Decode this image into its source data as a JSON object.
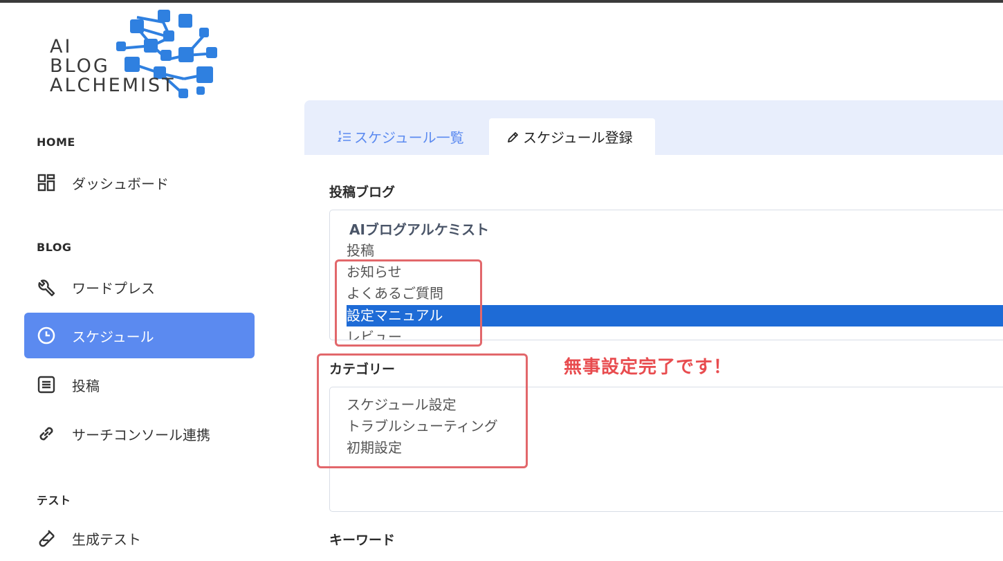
{
  "logo": {
    "line1": "AI",
    "line2": "BLOG",
    "line3": "ALCHEMIST"
  },
  "sidebar": {
    "sections": [
      {
        "title": "HOME"
      },
      {
        "title": "BLOG"
      },
      {
        "title": "テスト"
      }
    ],
    "items": [
      {
        "label": "ダッシュボード",
        "icon": "dashboard-icon"
      },
      {
        "label": "ワードプレス",
        "icon": "wrench-icon"
      },
      {
        "label": "スケジュール",
        "icon": "clock-icon",
        "active": true
      },
      {
        "label": "投稿",
        "icon": "document-icon"
      },
      {
        "label": "サーチコンソール連携",
        "icon": "link-icon"
      },
      {
        "label": "生成テスト",
        "icon": "flask-icon"
      }
    ]
  },
  "tabs": [
    {
      "label": "スケジュール一覧",
      "icon": "list-numbered-icon",
      "active": false
    },
    {
      "label": "スケジュール登録",
      "icon": "pencil-icon",
      "active": true
    }
  ],
  "form": {
    "blog_label": "投稿ブログ",
    "blog_group": "AIブログアルケミスト",
    "blog_options": [
      "投稿",
      "お知らせ",
      "よくあるご質問",
      "設定マニュアル",
      "レビュー"
    ],
    "blog_selected": "設定マニュアル",
    "category_label": "カテゴリー",
    "category_options": [
      "スケジュール設定",
      "トラブルシューティング",
      "初期設定"
    ],
    "keyword_label": "キーワード"
  },
  "annotation": "無事設定完了です！",
  "colors": {
    "accent": "#5b8af0",
    "selected": "#1e6bd6",
    "annotation_red": "#e84c4f",
    "tabbar_bg": "#e8eefc"
  }
}
